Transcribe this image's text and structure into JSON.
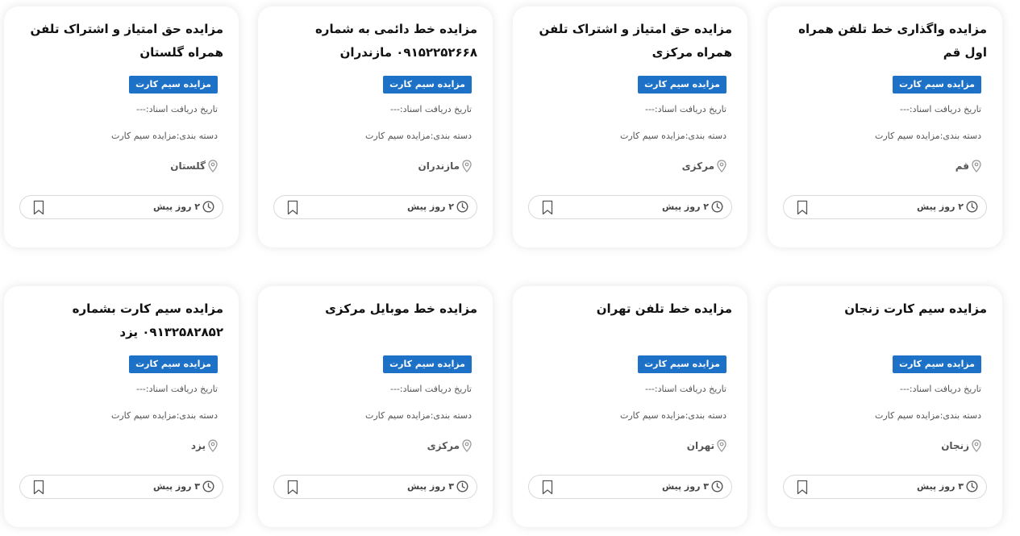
{
  "cards": [
    {
      "title": "مزایده واگذاری خط تلفن همراه اول قم",
      "badge": "مزایده سیم کارت",
      "date": "تاریخ دریافت اسناد:---",
      "category": "دسته بندی:مزایده سیم کارت",
      "location": "قم",
      "time": "۲ روز پیش"
    },
    {
      "title": "مزایده حق امتیاز و اشتراک تلفن همراه مرکزی",
      "badge": "مزایده سیم کارت",
      "date": "تاریخ دریافت اسناد:---",
      "category": "دسته بندی:مزایده سیم کارت",
      "location": "مرکزی",
      "time": "۲ روز پیش"
    },
    {
      "title": "مزایده خط دائمی به شماره ۰۹۱۵۲۲۵۲۶۶۸ مازندران",
      "badge": "مزایده سیم کارت",
      "date": "تاریخ دریافت اسناد:---",
      "category": "دسته بندی:مزایده سیم کارت",
      "location": "مازندران",
      "time": "۲ روز پیش"
    },
    {
      "title": "مزایده حق امتیاز و اشتراک تلفن همراه گلستان",
      "badge": "مزایده سیم کارت",
      "date": "تاریخ دریافت اسناد:---",
      "category": "دسته بندی:مزایده سیم کارت",
      "location": "گلستان",
      "time": "۲ روز پیش"
    },
    {
      "title": "مزایده سیم کارت زنجان",
      "badge": "مزایده سیم کارت",
      "date": "تاریخ دریافت اسناد:---",
      "category": "دسته بندی:مزایده سیم کارت",
      "location": "زنجان",
      "time": "۳ روز پیش"
    },
    {
      "title": "مزایده خط تلفن تهران",
      "badge": "مزایده سیم کارت",
      "date": "تاریخ دریافت اسناد:---",
      "category": "دسته بندی:مزایده سیم کارت",
      "location": "تهران",
      "time": "۳ روز پیش"
    },
    {
      "title": "مزایده خط موبایل مرکزی",
      "badge": "مزایده سیم کارت",
      "date": "تاریخ دریافت اسناد:---",
      "category": "دسته بندی:مزایده سیم کارت",
      "location": "مرکزی",
      "time": "۳ روز پیش"
    },
    {
      "title": "مزایده سیم کارت بشماره ۰۹۱۳۲۵۸۲۸۵۲ یزد",
      "badge": "مزایده سیم کارت",
      "date": "تاریخ دریافت اسناد:---",
      "category": "دسته بندی:مزایده سیم کارت",
      "location": "یزد",
      "time": "۳ روز پیش"
    }
  ],
  "icons": {
    "location": "map-pin-icon",
    "time": "clock-icon",
    "save": "bookmark-icon"
  },
  "colors": {
    "badge": "#1d72c8",
    "title": "#111111",
    "meta": "#555555",
    "border": "#d9d9d9"
  }
}
